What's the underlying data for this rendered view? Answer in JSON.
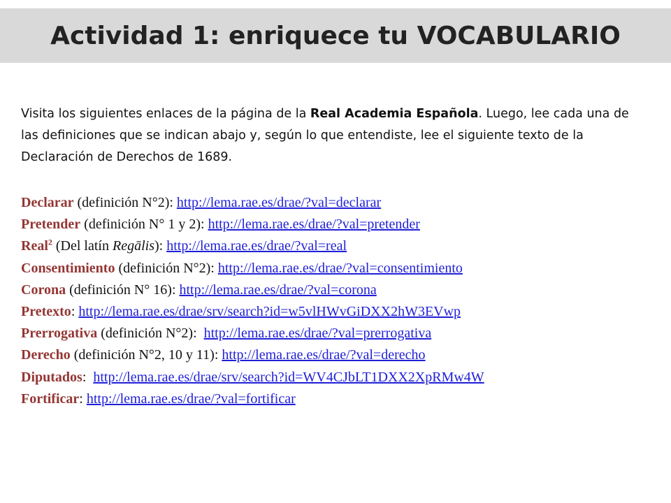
{
  "header": {
    "title": "Actividad 1: enriquece tu VOCABULARIO"
  },
  "intro": {
    "part1": "Visita los siguientes enlaces de la página de la ",
    "bold": "Real Academia Española",
    "part2": ". Luego, lee cada una de las definiciones que se indican abajo y, según lo que entendiste, lee el siguiente texto de la Declaración de Derechos de 1689."
  },
  "definitions": [
    {
      "term": "Declarar",
      "note": " (definición N°2): ",
      "url": "http://lema.rae.es/drae/?val=declarar"
    },
    {
      "term": "Pretender",
      "note": " (definición N° 1 y 2): ",
      "url": "http://lema.rae.es/drae/?val=pretender"
    },
    {
      "term": "Real",
      "sup": "2",
      "note_pre": " (Del latín ",
      "note_italic": "Regālis",
      "note_post": "): ",
      "url": "http://lema.rae.es/drae/?val=real"
    },
    {
      "term": "Consentimiento",
      "note": " (definición N°2): ",
      "url": "http://lema.rae.es/drae/?val=consentimiento"
    },
    {
      "term": "Corona",
      "note": " (definición N° 16): ",
      "url": "http://lema.rae.es/drae/?val=corona"
    },
    {
      "term": "Pretexto",
      "note": ": ",
      "url": "http://lema.rae.es/drae/srv/search?id=w5vlHWvGiDXX2hW3EVwp"
    },
    {
      "term": "Prerrogativa",
      "note": " (definición N°2):  ",
      "url": "http://lema.rae.es/drae/?val=prerrogativa"
    },
    {
      "term": "Derecho",
      "note": " (definición N°2, 10 y 11): ",
      "url": "http://lema.rae.es/drae/?val=derecho"
    },
    {
      "term": "Diputados",
      "note": ":  ",
      "url": "http://lema.rae.es/drae/srv/search?id=WV4CJbLT1DXX2XpRMw4W"
    },
    {
      "term": "Fortificar",
      "note": ": ",
      "url": "http://lema.rae.es/drae/?val=fortificar"
    }
  ]
}
